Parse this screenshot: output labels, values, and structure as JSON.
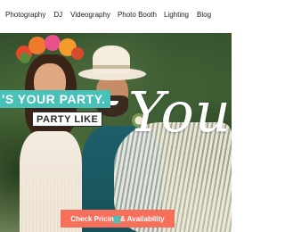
{
  "nav": {
    "items": [
      "Photography",
      "DJ",
      "Videography",
      "Photo Booth",
      "Lighting",
      "Blog"
    ]
  },
  "hero": {
    "banner_party": "'S YOUR PARTY.",
    "banner_like": "PARTY LIKE",
    "script_word": "You",
    "cta_label": "Check Pricing & Availability"
  },
  "colors": {
    "teal": "#48c1b8",
    "cta": "#f56f5a"
  },
  "icons": [
    "teal-logo-icon"
  ]
}
